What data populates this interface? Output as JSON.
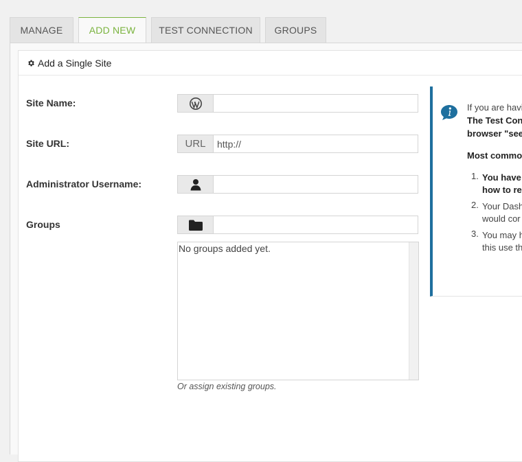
{
  "tabs": [
    {
      "label": "MANAGE",
      "active": false
    },
    {
      "label": "ADD NEW",
      "active": true
    },
    {
      "label": "TEST CONNECTION",
      "active": false
    },
    {
      "label": "GROUPS",
      "active": false
    }
  ],
  "section": {
    "title": "Add a Single Site",
    "icon": "gear-icon"
  },
  "form": {
    "site_name": {
      "label": "Site Name:",
      "icon": "wordpress-icon",
      "value": ""
    },
    "site_url": {
      "label": "Site URL:",
      "addon": "URL",
      "value": "http://"
    },
    "admin_username": {
      "label": "Administrator Username:",
      "icon": "user-icon",
      "value": ""
    },
    "groups": {
      "label": "Groups",
      "icon": "folder-icon",
      "value": "",
      "empty_message": "No groups added yet.",
      "hint": "Or assign existing groups."
    }
  },
  "info_box": {
    "icon": "info-icon",
    "line1": "If you are havi",
    "line2": "The Test Conn",
    "line3": "browser \"sees",
    "line4": "Most commo",
    "items": [
      {
        "num": "1.",
        "line1": "You have",
        "line2": "how to re"
      },
      {
        "num": "2.",
        "line1": "Your Dash",
        "line2": "would cor"
      },
      {
        "num": "3.",
        "line1": "You may h",
        "line2": "this use th"
      }
    ]
  },
  "colors": {
    "accent_green": "#7ab33e",
    "info_blue": "#1e6f9e"
  }
}
